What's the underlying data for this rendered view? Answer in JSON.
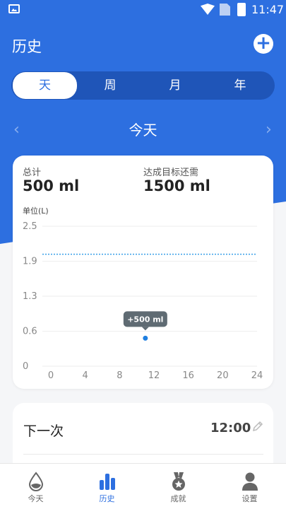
{
  "status_bar": {
    "time": "11:47"
  },
  "header": {
    "title": "历史",
    "add_icon": "plus-icon"
  },
  "period_tabs": [
    {
      "label": "天",
      "active": true
    },
    {
      "label": "周",
      "active": false
    },
    {
      "label": "月",
      "active": false
    },
    {
      "label": "年",
      "active": false
    }
  ],
  "date_nav": {
    "title": "今天",
    "prev_icon": "chevron-left-icon",
    "next_icon": "chevron-right-icon"
  },
  "summary": {
    "total_label": "总计",
    "total_value": "500 ml",
    "remaining_label": "达成目标还需",
    "remaining_value": "1500 ml",
    "unit_label": "单位(L)"
  },
  "chart_data": {
    "type": "scatter",
    "x_ticks": [
      "0",
      "4",
      "8",
      "12",
      "16",
      "20",
      "24"
    ],
    "y_ticks": [
      "0",
      "0.6",
      "1.3",
      "1.9",
      "2.5"
    ],
    "xlim": [
      0,
      24
    ],
    "ylim": [
      0,
      2.5
    ],
    "points": [
      {
        "x": 11,
        "y": 0.5,
        "label": "+500 ml"
      }
    ],
    "goal_line": 2.0,
    "colors": {
      "point": "#1f7fe0",
      "goal_line": "#3aa0e8",
      "bubble": "#5f6b73"
    }
  },
  "next": {
    "label": "下一次",
    "time": "12:00",
    "edit_icon": "pencil-icon"
  },
  "bottom_nav": [
    {
      "label": "今天",
      "icon": "water-drop-icon",
      "active": false
    },
    {
      "label": "历史",
      "icon": "bar-chart-icon",
      "active": true
    },
    {
      "label": "成就",
      "icon": "medal-icon",
      "active": false
    },
    {
      "label": "设置",
      "icon": "person-icon",
      "active": false
    }
  ],
  "colors": {
    "primary": "#2d6fe0",
    "background": "#f5f6f8"
  }
}
